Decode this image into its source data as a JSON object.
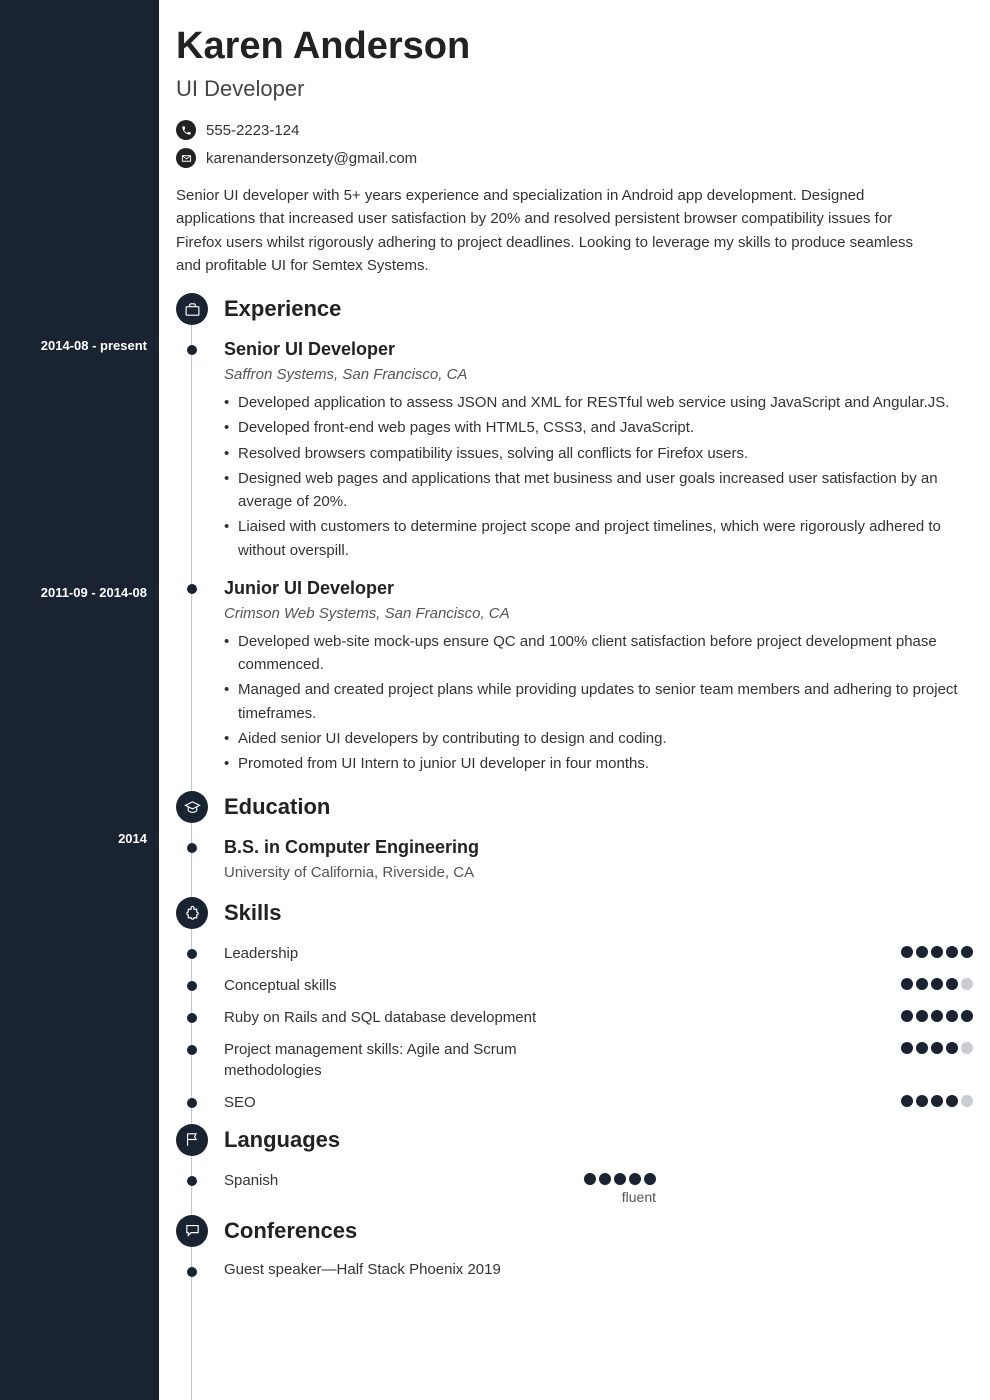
{
  "header": {
    "name": "Karen Anderson",
    "title": "UI Developer",
    "phone": "555-2223-124",
    "email": "karenandersonzety@gmail.com",
    "summary": "Senior UI developer with 5+ years experience and specialization in Android app development. Designed applications that increased user satisfaction by 20% and resolved persistent browser compatibility issues for Firefox users whilst rigorously adhering to project deadlines. Looking to leverage my skills to produce seamless and profitable UI for Semtex Systems."
  },
  "sections": {
    "experience": {
      "title": "Experience",
      "entries": [
        {
          "dates": "2014-08 - present",
          "title": "Senior UI Developer",
          "sub": "Saffron Systems, San Francisco, CA",
          "bullets": [
            "Developed application to assess JSON and XML for RESTful web service using JavaScript and Angular.JS.",
            "Developed front-end web pages with HTML5, CSS3, and JavaScript.",
            "Resolved browsers compatibility issues, solving all conflicts for Firefox users.",
            "Designed web pages and applications that met business and user goals increased user satisfaction by an average of 20%.",
            "Liaised with customers to determine project scope and project timelines, which were rigorously adhered to without overspill."
          ]
        },
        {
          "dates": "2011-09 - 2014-08",
          "title": "Junior UI Developer",
          "sub": "Crimson Web Systems, San Francisco, CA",
          "bullets": [
            "Developed web-site mock-ups ensure QC and 100% client satisfaction before project development phase commenced.",
            "Managed and created project plans while providing updates to senior team members and adhering to project timeframes.",
            "Aided senior UI developers by contributing to design and coding.",
            "Promoted from UI Intern to junior UI developer in four months."
          ]
        }
      ]
    },
    "education": {
      "title": "Education",
      "entries": [
        {
          "dates": "2014",
          "title": "B.S. in Computer Engineering",
          "sub": "University of California, Riverside, CA"
        }
      ]
    },
    "skills": {
      "title": "Skills",
      "items": [
        {
          "name": "Leadership",
          "rating": 5
        },
        {
          "name": "Conceptual skills",
          "rating": 4
        },
        {
          "name": "Ruby on Rails and SQL database development",
          "rating": 5
        },
        {
          "name": "Project management skills: Agile and Scrum methodologies",
          "rating": 4
        },
        {
          "name": "SEO",
          "rating": 4
        }
      ]
    },
    "languages": {
      "title": "Languages",
      "items": [
        {
          "name": "Spanish",
          "rating": 5,
          "label": "fluent"
        }
      ]
    },
    "conferences": {
      "title": "Conferences",
      "items": [
        "Guest speaker—Half Stack Phoenix 2019"
      ]
    }
  }
}
